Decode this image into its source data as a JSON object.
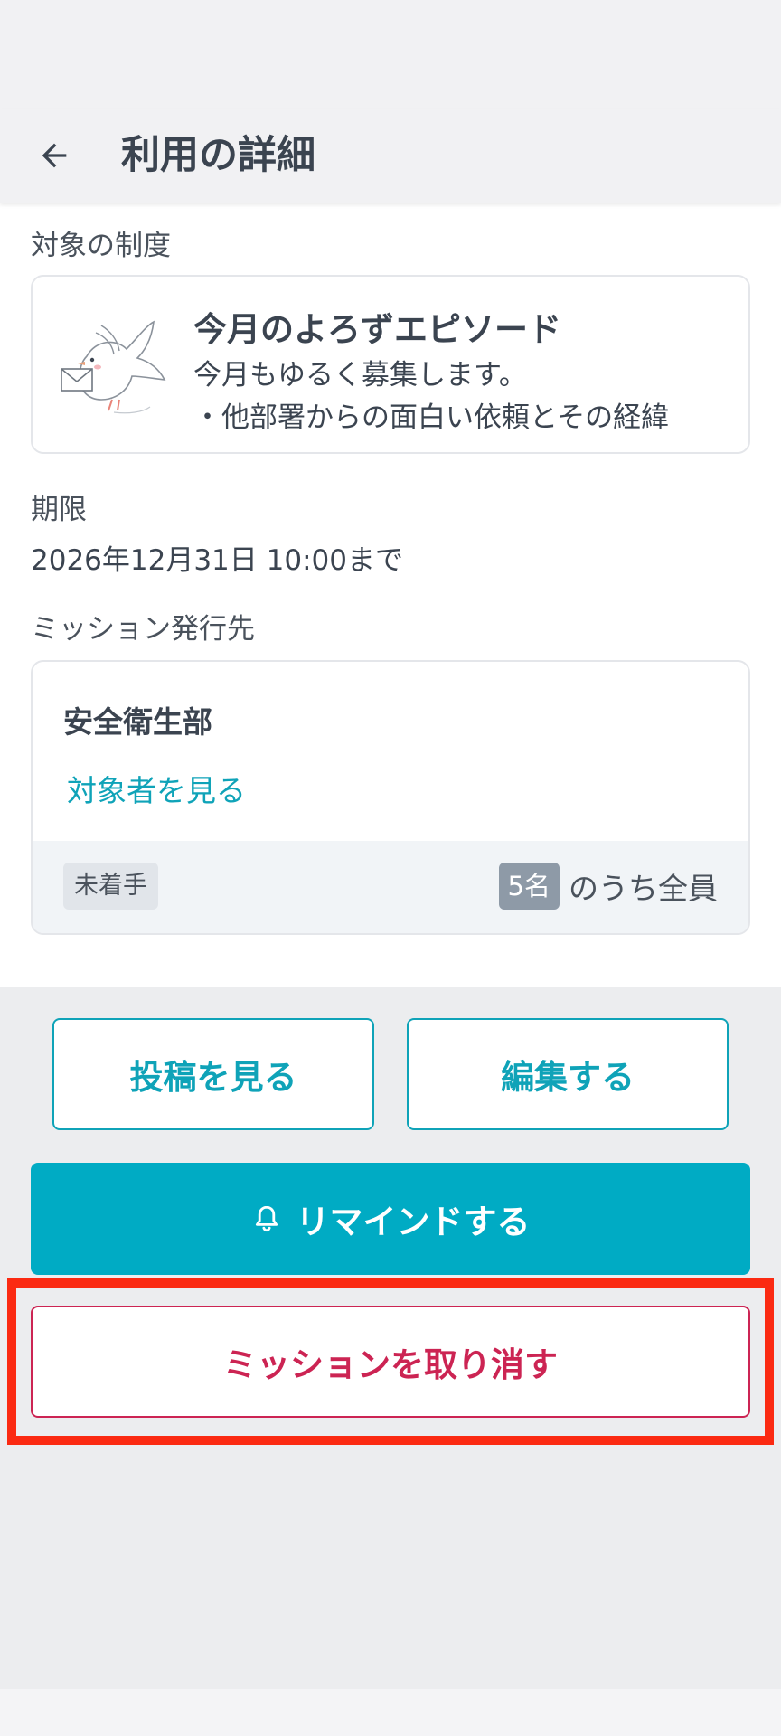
{
  "header": {
    "title": "利用の詳細",
    "back_icon": "arrow-left-icon"
  },
  "system": {
    "label": "対象の制度",
    "name": "今月のよろずエピソード",
    "description": "今月もゆるく募集します。\n・他部署からの面白い依頼とその経緯",
    "illustration": "dove-with-letter-illustration"
  },
  "deadline": {
    "label": "期限",
    "value": "2026年12月31日 10:00まで"
  },
  "destination": {
    "label": "ミッション発行先",
    "department": "安全衛生部",
    "view_targets_link": "対象者を見る",
    "status": "未着手",
    "count": "5名",
    "count_suffix": "のうち全員"
  },
  "actions": {
    "view_posts": "投稿を見る",
    "edit": "編集する",
    "remind": "リマインドする",
    "remind_icon": "bell-icon",
    "cancel_mission": "ミッションを取り消す"
  },
  "colors": {
    "accent": "#00abc4",
    "danger": "#cc2453",
    "highlight": "#fb2a12"
  }
}
